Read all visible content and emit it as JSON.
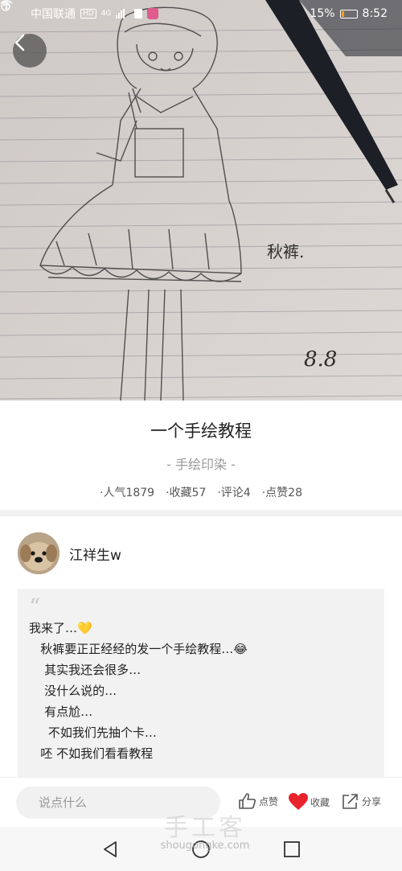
{
  "status_bar": {
    "carrier": "中国联通",
    "network_badge": "HD",
    "network_type": "4G",
    "battery": "15%",
    "time": "8:52"
  },
  "hero": {
    "signature_text": "秋裤.",
    "date_text": "8.8"
  },
  "article": {
    "title": "一个手绘教程",
    "category": "- 手绘印染 -",
    "stats": {
      "popularity": "·人气1879",
      "favorites": "·收藏57",
      "comments": "·评论4",
      "likes": "·点赞28"
    }
  },
  "author": {
    "name": "江祥生w"
  },
  "intro": {
    "quote_mark": "“",
    "lines": [
      "我来了…💛",
      "   秋裤要正正经经的发一个手绘教程…😂",
      "    其实我还会很多…",
      "    没什么说的…",
      "    有点尬…",
      "     不如我们先抽个卡…",
      "   呸 不如我们看看教程"
    ]
  },
  "action_bar": {
    "comment_placeholder": "说点什么",
    "like_label": "点赞",
    "favorite_label": "收藏",
    "share_label": "分享"
  },
  "watermark": {
    "title": "手工客",
    "url": "shougongke.com"
  },
  "colors": {
    "heart": "#e8232c",
    "divider": "#f1f1f1",
    "card_bg": "#f2f2f2"
  },
  "icons": [
    "back-arrow-icon",
    "thumbs-up-icon",
    "heart-icon",
    "share-icon",
    "nav-back-icon",
    "nav-home-icon",
    "nav-recents-icon"
  ]
}
